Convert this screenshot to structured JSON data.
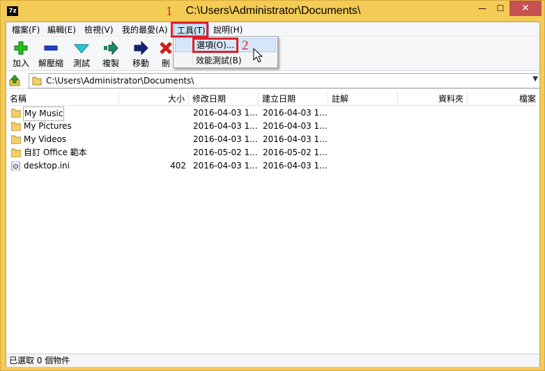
{
  "window": {
    "title": "C:\\Users\\Administrator\\Documents\\",
    "app_icon": "7z",
    "controls": {
      "minimize": "—",
      "maximize": "☐",
      "close": "✕"
    }
  },
  "menubar": {
    "items": [
      {
        "label": "檔案(F)"
      },
      {
        "label": "編輯(E)"
      },
      {
        "label": "檢視(V)"
      },
      {
        "label": "我的最愛(A)"
      },
      {
        "label": "工具(T)"
      },
      {
        "label": "說明(H)"
      }
    ]
  },
  "toolbar": {
    "buttons": [
      {
        "label": "加入",
        "icon": "plus-icon"
      },
      {
        "label": "解壓縮",
        "icon": "minus-icon"
      },
      {
        "label": "測試",
        "icon": "check-icon"
      },
      {
        "label": "複製",
        "icon": "copy-arrow-icon"
      },
      {
        "label": "移動",
        "icon": "move-arrow-icon"
      },
      {
        "label": "刪",
        "icon": "delete-x-icon"
      }
    ]
  },
  "address": {
    "path": "C:\\Users\\Administrator\\Documents\\"
  },
  "columns": [
    "名稱",
    "大小",
    "修改日期",
    "建立日期",
    "註解",
    "資料夾",
    "檔案"
  ],
  "files": [
    {
      "name": "My Music",
      "size": "",
      "modified": "2016-04-03 1...",
      "created": "2016-04-03 1...",
      "type": "folder"
    },
    {
      "name": "My Pictures",
      "size": "",
      "modified": "2016-04-03 1...",
      "created": "2016-04-03 1...",
      "type": "folder"
    },
    {
      "name": "My Videos",
      "size": "",
      "modified": "2016-04-03 1...",
      "created": "2016-04-03 1...",
      "type": "folder"
    },
    {
      "name": "自訂 Office 範本",
      "size": "",
      "modified": "2016-05-02 1...",
      "created": "2016-05-02 1...",
      "type": "folder"
    },
    {
      "name": "desktop.ini",
      "size": "402",
      "modified": "2016-04-03 1...",
      "created": "2016-04-03 1...",
      "type": "file"
    }
  ],
  "tools_menu": {
    "items": [
      {
        "label": "選項(O)..."
      },
      {
        "label": "效能測試(B)"
      }
    ]
  },
  "annotations": {
    "step1": "1",
    "step2": "2",
    "color": "#e0202a"
  },
  "status": {
    "text": "已選取 0 個物件"
  }
}
